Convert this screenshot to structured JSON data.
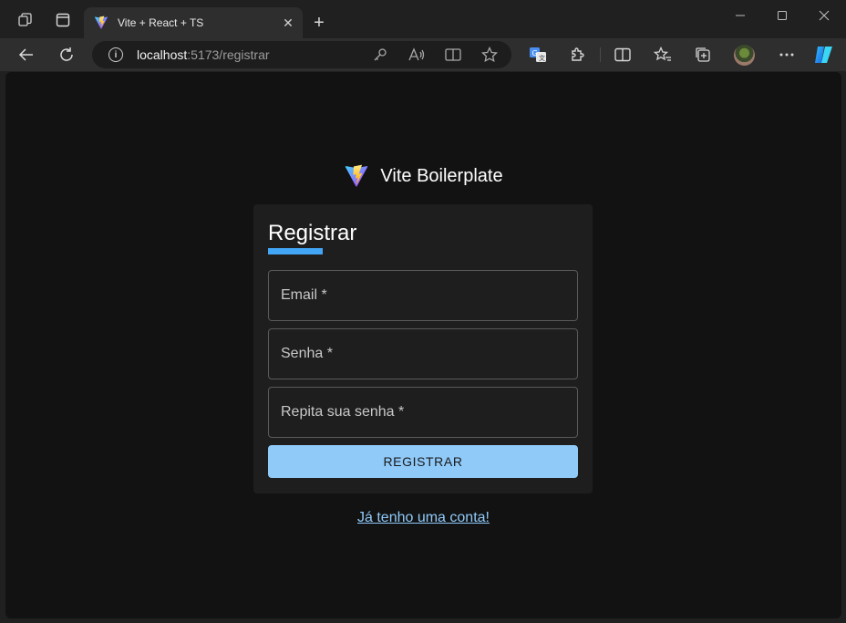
{
  "browser": {
    "tab_title": "Vite + React + TS",
    "url_host": "localhost",
    "url_rest": ":5173/registrar",
    "icons": {
      "workspaces": "workspaces-icon",
      "tab_actions": "tab-actions-icon",
      "favicon": "vite-logo-icon",
      "close_tab": "close-icon",
      "new_tab": "plus-icon",
      "minimize": "minimize-icon",
      "maximize": "maximize-icon",
      "close_window": "close-window-icon",
      "back": "back-arrow-icon",
      "refresh": "refresh-icon",
      "site_info": "info-icon",
      "password": "key-icon",
      "read_aloud": "read-aloud-icon",
      "immersive_reader": "immersive-reader-icon",
      "favorite": "star-icon",
      "translate": "translate-icon",
      "extensions": "puzzle-icon",
      "split_screen": "split-screen-icon",
      "favorites": "favorites-icon",
      "collections": "collections-icon",
      "profile": "avatar",
      "more": "more-icon",
      "copilot": "copilot-icon"
    }
  },
  "page": {
    "brand_name": "Vite Boilerplate",
    "form": {
      "title": "Registrar",
      "email_label": "Email *",
      "password_label": "Senha *",
      "repeat_password_label": "Repita sua senha *",
      "submit_label": "REGISTRAR"
    },
    "login_link": "Já tenho uma conta!"
  },
  "colors": {
    "accent": "#42a5f5",
    "button": "#90caf9",
    "link": "#90caf9",
    "page_bg": "#121212",
    "card_bg": "#1e1e1e"
  }
}
